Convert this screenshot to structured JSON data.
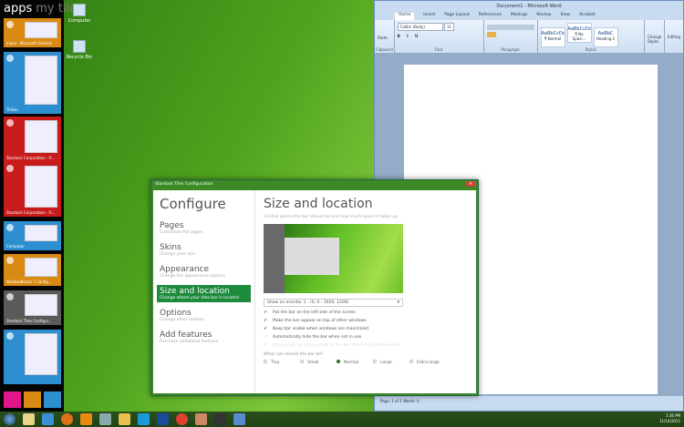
{
  "sidebar": {
    "title": "apps",
    "title2": "my tiles",
    "tiles": [
      {
        "label": "Inbox - Microsoft Outlook",
        "color": "#d98a12"
      },
      {
        "label": "Trillian",
        "color": "#2d8fd0"
      },
      {
        "label": "Stardock Corporation - Fi...",
        "color": "#c81c1c"
      },
      {
        "label": "Stardock Corporation - Fi...",
        "color": "#c81c1c"
      },
      {
        "label": "Computer",
        "color": "#2d8fd0"
      },
      {
        "label": "WindowBlinds 7 Config...",
        "color": "#d98a12"
      },
      {
        "label": "Stardock Tiles Configur...",
        "color": "#5a5a5a"
      },
      {
        "label": "",
        "color": "#2d8fd0"
      }
    ]
  },
  "desktop": {
    "icons": [
      "Computer",
      "Recycle Bin"
    ]
  },
  "word": {
    "title": "Document1 - Microsoft Word",
    "tabs": [
      "Home",
      "Insert",
      "Page Layout",
      "References",
      "Mailings",
      "Review",
      "View",
      "Acrobat"
    ],
    "paste": "Paste",
    "font": "Calibri (Body)",
    "size": "11",
    "groups": [
      "Clipboard",
      "Font",
      "Paragraph",
      "Styles"
    ],
    "styles": [
      {
        "sample": "AaBbCcDc",
        "name": "¶ Normal"
      },
      {
        "sample": "AaBbCcDc",
        "name": "¶ No Spaci..."
      },
      {
        "sample": "AaBbC",
        "name": "Heading 1"
      }
    ],
    "change_styles": "Change Styles",
    "editing": "Editing",
    "status": "Page: 1 of 1   Words: 0"
  },
  "dialog": {
    "title": "Stardock Tiles Configuration",
    "heading": "Configure",
    "nav": [
      {
        "title": "Pages",
        "desc": "Customize the pages"
      },
      {
        "title": "Skins",
        "desc": "Change your skin"
      },
      {
        "title": "Appearance",
        "desc": "Change the appearance options"
      },
      {
        "title": "Size and location",
        "desc": "Change where your tiles bar is located"
      },
      {
        "title": "Options",
        "desc": "Change other options"
      },
      {
        "title": "Add features",
        "desc": "Purchase additional features"
      }
    ],
    "section_title": "Size and location",
    "section_desc": "Control where the bar should be and how much space it takes up",
    "monitor": "Show on monitor 1 - (0, 0 - 1920, 1200)",
    "checks": [
      {
        "label": "Put the bar on the left side of the screen",
        "checked": true
      },
      {
        "label": "Make the bar appear on top of other windows",
        "checked": true
      },
      {
        "label": "Keep bar visible when windows are maximized",
        "checked": true
      },
      {
        "label": "Automatically hide the bar when not in use",
        "checked": false
      },
      {
        "label": "Show a tab for easy access to the bar when in autohide mode",
        "checked": false,
        "disabled": true
      }
    ],
    "size_question": "What size should the bar be?",
    "sizes": [
      "Tiny",
      "Small",
      "Normal",
      "Large",
      "Extra large"
    ],
    "selected_size": "Normal"
  },
  "tray": {
    "time": "1:36 PM",
    "date": "11/14/2011"
  }
}
